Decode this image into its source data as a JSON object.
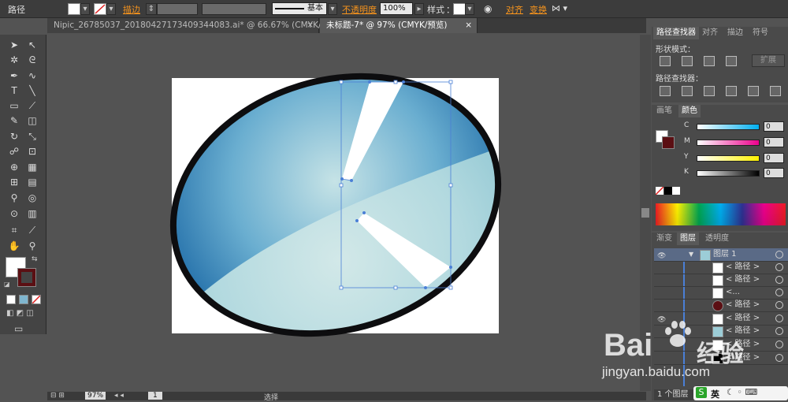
{
  "control_bar": {
    "object_type": "路径",
    "stroke_label": "描边",
    "stroke_profile_label": "基本",
    "opacity_label": "不透明度",
    "opacity_value": "100%",
    "style_label": "样式",
    "align_label": "对齐",
    "transform_label": "变换"
  },
  "tabs": [
    {
      "label": "Nipic_26785037_20180427173409344083.ai* @ 66.67% (CMYK/预览)",
      "active": false
    },
    {
      "label": "未标题-7* @ 97% (CMYK/预览)",
      "active": true
    }
  ],
  "status_bar": {
    "zoom": "97%",
    "page": "1",
    "selection_label": "选择"
  },
  "pathfinder_panel": {
    "tabs": [
      "路径查找器",
      "对齐",
      "描边",
      "符号"
    ],
    "shape_modes_label": "形状模式：",
    "expand_label": "扩展",
    "pathfinders_label": "路径查找器："
  },
  "color_panel": {
    "tabs": [
      "画笔",
      "颜色"
    ],
    "channels": [
      {
        "name": "C",
        "value": "0",
        "color": "#00aeef"
      },
      {
        "name": "M",
        "value": "0",
        "color": "#ec008c"
      },
      {
        "name": "Y",
        "value": "0",
        "color": "#fff200"
      },
      {
        "name": "K",
        "value": "0",
        "color": "#000000"
      }
    ]
  },
  "layers_panel": {
    "tabs": [
      "渐变",
      "图层",
      "透明度"
    ],
    "layer_name": "图层 1",
    "items": [
      {
        "label": "< 路径 >"
      },
      {
        "label": "< 路径 >"
      },
      {
        "label": "<..."
      },
      {
        "label": "< 路径 >"
      },
      {
        "label": "< 路径 >"
      },
      {
        "label": "< 路径 >"
      },
      {
        "label": "< 路径 >"
      },
      {
        "label": "< 路径 >"
      }
    ],
    "footer": "1 个图层"
  },
  "watermark": {
    "brand": "Bai",
    "brand_suffix": "经验",
    "url": "jingyan.baidu.com"
  },
  "ime_label": "英",
  "colors": {
    "ellipse_stroke": "#0d0d0f",
    "gradient_dark": "#1e6fa8",
    "gradient_light": "#c4e2e6",
    "selection": "#4a7fd6",
    "accent_orange": "#f7941d"
  }
}
